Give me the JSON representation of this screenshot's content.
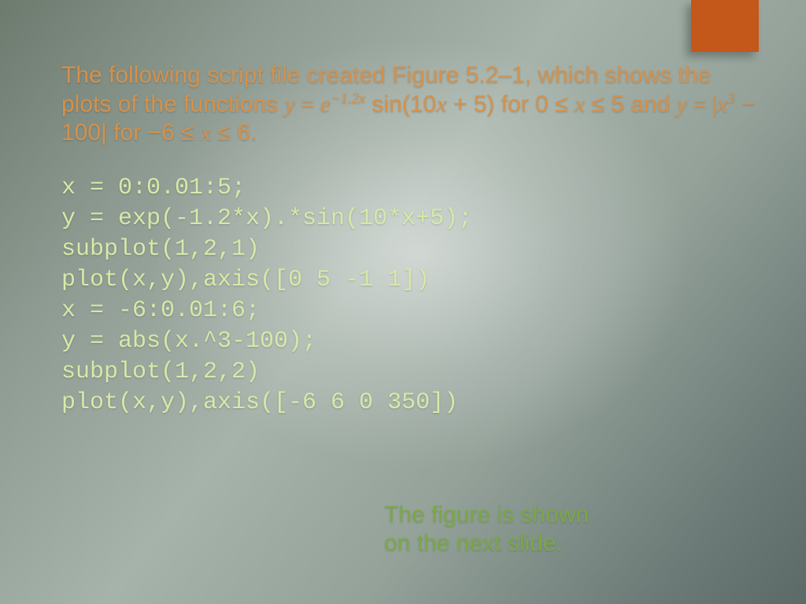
{
  "desc": {
    "t1": "The following script file created Figure 5.2–1, which shows the plots of the functions ",
    "y": "y",
    "eq": " = ",
    "e": "e",
    "exp": "−1.2x",
    "t2": " sin(10",
    "x": "x",
    "t3": " + 5) for 0 ≤ ",
    "t4": " ≤ 5 and ",
    "eq2": " = |",
    "cube": "3",
    "t5": " − 100| for −6 ≤ ",
    "t6": " ≤ 6."
  },
  "code": {
    "l1": "x = 0:0.01:5;",
    "l2": "y = exp(-1.2*x).*sin(10*x+5);",
    "l3": "subplot(1,2,1)",
    "l4": "plot(x,y),axis([0 5 -1 1])",
    "l5": "x = -6:0.01:6;",
    "l6": "y = abs(x.^3-100);",
    "l7": "subplot(1,2,2)",
    "l8": "plot(x,y),axis([-6 6 0 350])"
  },
  "footer": {
    "line1": "The figure is shown",
    "line2": "on the next slide."
  }
}
